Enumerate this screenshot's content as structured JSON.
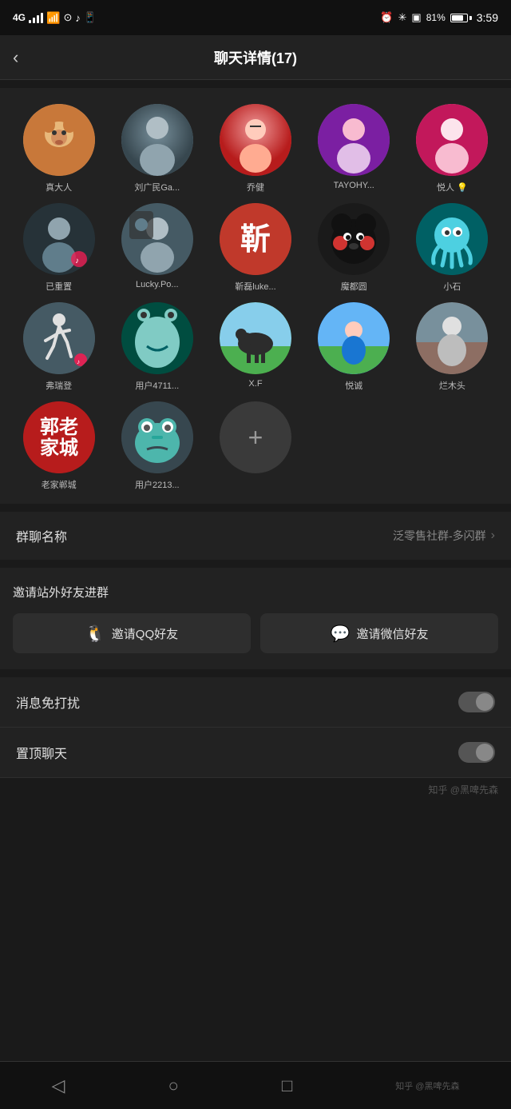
{
  "statusBar": {
    "signal": "4G",
    "time": "3:59",
    "battery": "81%",
    "icons": [
      "alarm",
      "bluetooth",
      "screen"
    ]
  },
  "header": {
    "title": "聊天详情(17)",
    "backLabel": "‹"
  },
  "members": [
    {
      "name": "真大人",
      "avatarClass": "av1",
      "emoji": "🐕"
    },
    {
      "name": "刘广民Ga...",
      "avatarClass": "av2",
      "emoji": "👤"
    },
    {
      "name": "乔健",
      "avatarClass": "av3",
      "emoji": "👤"
    },
    {
      "name": "TAYOHY...",
      "avatarClass": "av4",
      "emoji": "👤"
    },
    {
      "name": "悦人 💡",
      "avatarClass": "av5",
      "emoji": "👤"
    },
    {
      "name": "已重置",
      "avatarClass": "av6",
      "emoji": "👤"
    },
    {
      "name": "Lucky.Po...",
      "avatarClass": "av7",
      "emoji": "👤"
    },
    {
      "name": "靳磊luke...",
      "avatarClass": "av8",
      "text": "靳"
    },
    {
      "name": "魔都圆",
      "avatarClass": "av9",
      "emoji": "🐻"
    },
    {
      "name": "小石",
      "avatarClass": "av10",
      "emoji": "🐙"
    },
    {
      "name": "弗瑞登",
      "avatarClass": "av13",
      "emoji": "🏃"
    },
    {
      "name": "用户4711...",
      "avatarClass": "av12",
      "emoji": "👾"
    },
    {
      "name": "X.F",
      "avatarClass": "av14",
      "emoji": "🐴"
    },
    {
      "name": "悦诚",
      "avatarClass": "av15",
      "emoji": "👤"
    },
    {
      "name": "烂木头",
      "avatarClass": "av16",
      "emoji": "👤"
    },
    {
      "name": "老家郸城",
      "avatarClass": "av17",
      "text": "郭"
    },
    {
      "name": "用户2213...",
      "avatarClass": "av12",
      "emoji": "😐"
    }
  ],
  "settings": {
    "groupNameLabel": "群聊名称",
    "groupNameValue": "泛零售社群-多闪群"
  },
  "invite": {
    "sectionTitle": "邀请站外好友进群",
    "qqButton": "邀请QQ好友",
    "wechatButton": "邀请微信好友"
  },
  "toggles": [
    {
      "label": "消息免打扰",
      "enabled": false
    },
    {
      "label": "置顶聊天",
      "enabled": false
    }
  ],
  "bottomNav": [
    {
      "icon": "◁",
      "label": ""
    },
    {
      "icon": "○",
      "label": ""
    },
    {
      "icon": "□",
      "label": ""
    }
  ],
  "watermark": "知乎 @黑啤先森"
}
